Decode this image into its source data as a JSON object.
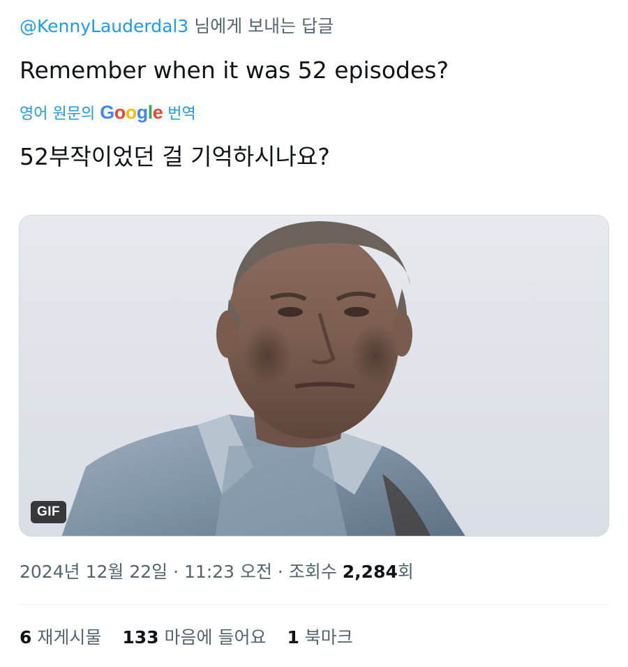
{
  "reply": {
    "handle": "@KennyLauderdal3",
    "suffix": " 님에게 보내는 답글"
  },
  "tweet": {
    "text": "Remember when it was 52 episodes?",
    "translate_prefix": "영어 원문의 ",
    "translate_brand": "Google",
    "translate_suffix": " 번역",
    "translated_text": "52부작이었던 걸 기억하시나요?"
  },
  "media": {
    "badge": "GIF"
  },
  "meta": {
    "date": "2024년 12월 22일",
    "separator1": " · ",
    "time": "11:23 오전",
    "separator2": " · ",
    "views_label": "조회수 ",
    "views_count": "2,284",
    "views_suffix": "회"
  },
  "stats": {
    "reposts_count": "6",
    "reposts_label": " 재게시물",
    "likes_count": "133",
    "likes_label": " 마음에 들어요",
    "bookmarks_count": "1",
    "bookmarks_label": " 북마크"
  },
  "colors": {
    "link": "#1d9bf0",
    "secondary_text": "#536471",
    "primary_text": "#0f1419"
  }
}
